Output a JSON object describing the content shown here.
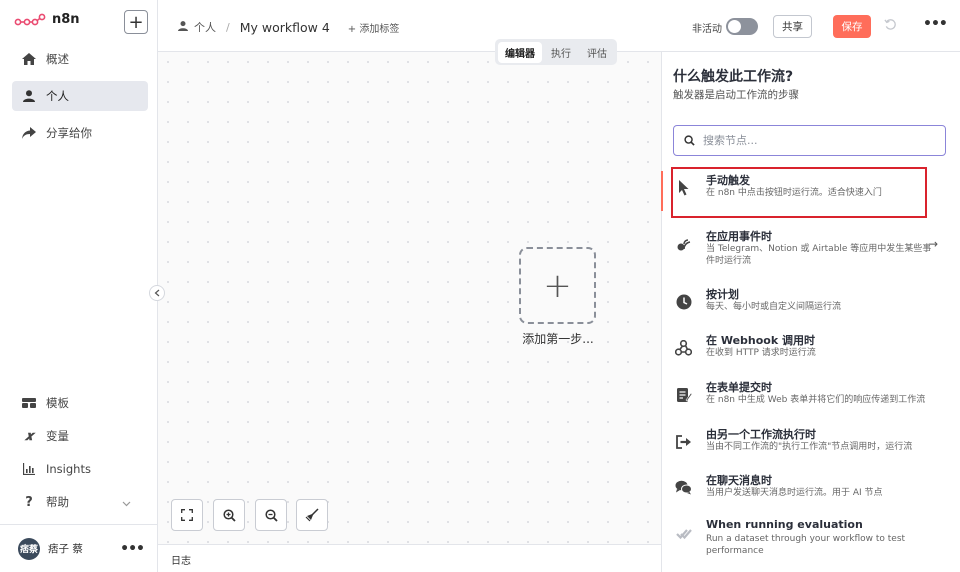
{
  "brand": {
    "name": "n8n"
  },
  "sidebar": {
    "add_label": "+",
    "top_items": [
      {
        "label": "概述",
        "icon": "home-icon"
      },
      {
        "label": "个人",
        "icon": "user-icon",
        "active": true
      },
      {
        "label": "分享给你",
        "icon": "share-icon"
      }
    ],
    "bottom_items": [
      {
        "label": "模板",
        "icon": "templates-icon"
      },
      {
        "label": "变量",
        "icon": "variables-icon"
      },
      {
        "label": "Insights",
        "icon": "insights-icon"
      },
      {
        "label": "帮助",
        "icon": "help-icon"
      }
    ],
    "user": {
      "avatar_text": "痞蔡",
      "name": "痞子 蔡",
      "more": "•••"
    }
  },
  "header": {
    "breadcrumb_project": "个人",
    "separator": "/",
    "workflow_name": "My workflow 4",
    "add_tag": "+ 添加标签",
    "inactive_label": "非活动",
    "share_label": "共享",
    "save_label": "保存",
    "more": "•••"
  },
  "canvas": {
    "tabs": [
      {
        "label": "编辑器",
        "active": true
      },
      {
        "label": "执行"
      },
      {
        "label": "评估"
      }
    ],
    "add_first_step_plus": "+",
    "add_first_step_label": "添加第一步...",
    "log_label": "日志"
  },
  "panel": {
    "title": "什么触发此工作流?",
    "subtitle": "触发器是启动工作流的步骤",
    "search_placeholder": "搜索节点...",
    "triggers": [
      {
        "title": "手动触发",
        "desc": "在 n8n 中点击按钮时运行流。适合快速入门",
        "icon": "cursor-icon"
      },
      {
        "title": "在应用事件时",
        "desc": "当 Telegram、Notion 或 Airtable 等应用中发生某些事件时运行流",
        "icon": "app-event-icon",
        "arrow": "→"
      },
      {
        "title": "按计划",
        "desc": "每天、每小时或自定义间隔运行流",
        "icon": "clock-icon"
      },
      {
        "title": "在 Webhook 调用时",
        "desc": "在收到 HTTP 请求时运行流",
        "icon": "webhook-icon"
      },
      {
        "title": "在表单提交时",
        "desc": "在 n8n 中生成 Web 表单并将它们的响应传递到工作流",
        "icon": "form-icon"
      },
      {
        "title": "由另一个工作流执行时",
        "desc": "当由不同工作流的\"执行工作流\"节点调用时，运行流",
        "icon": "sub-workflow-icon"
      },
      {
        "title": "在聊天消息时",
        "desc": "当用户发送聊天消息时运行流。用于 AI 节点",
        "icon": "chat-icon"
      },
      {
        "title": "When running evaluation",
        "desc": "Run a dataset through your workflow to test performance",
        "icon": "check-icon"
      }
    ]
  },
  "colors": {
    "accent": "#ff6d5a",
    "highlight": "#d9232d",
    "search_border": "#8b85d9"
  }
}
